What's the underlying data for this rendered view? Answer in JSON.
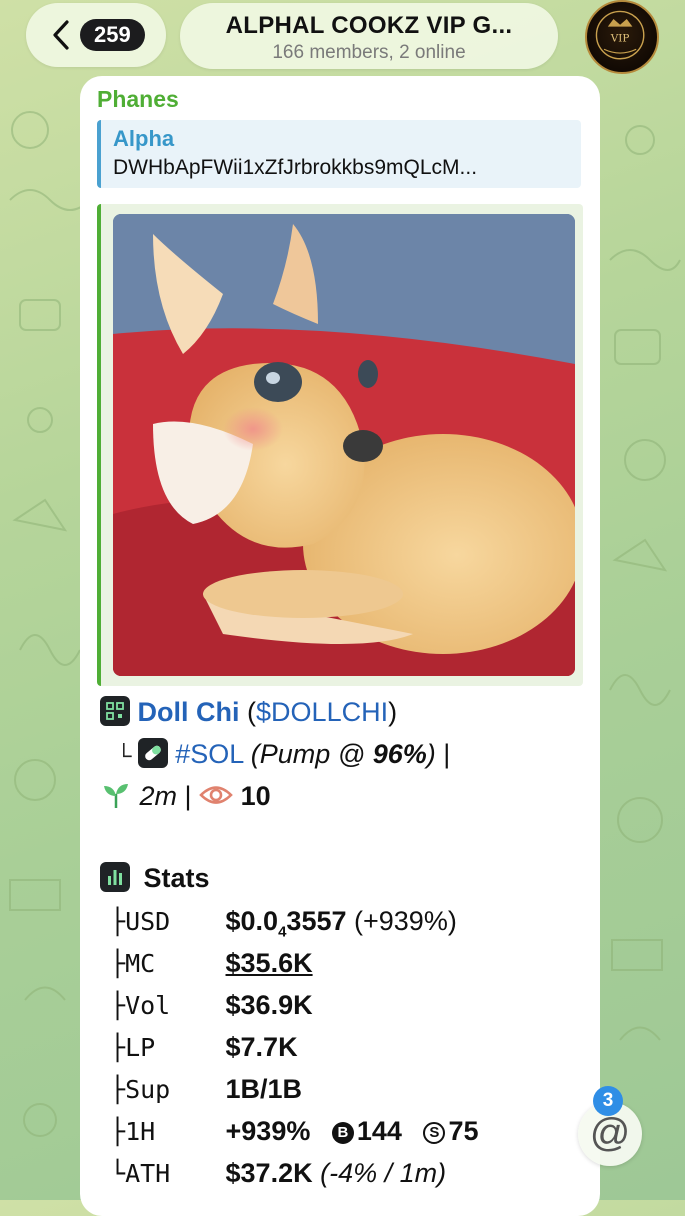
{
  "header": {
    "unread_count": "259",
    "chat_title": "ALPHAL COOKZ VIP G...",
    "chat_subtitle": "166 members, 2 online",
    "avatar_text": "VIP"
  },
  "message": {
    "sender": "Phanes",
    "reply": {
      "author": "Alpha",
      "text": "DWHbApFWii1xZfJrbrokkbs9mQLcM..."
    },
    "token_name": "Doll Chi",
    "token_ticker": "$DOLLCHI",
    "chain_tag": "#SOL",
    "pump_label": "(Pump @ ",
    "pump_pct": "96%",
    "pump_close": ")",
    "age": "2m",
    "views": "10",
    "stats_title": "Stats",
    "stats": {
      "usd_label": "USD",
      "usd_value_pre": "$0.0",
      "usd_value_sub": "4",
      "usd_value_post": "3557",
      "usd_change": "(+939%)",
      "mc_label": "MC",
      "mc_value": "$35.6K",
      "vol_label": "Vol",
      "vol_value": "$36.9K",
      "lp_label": "LP",
      "lp_value": "$7.7K",
      "sup_label": "Sup",
      "sup_value": "1B/1B",
      "h1_label": "1H",
      "h1_value": "+939%",
      "h1_buys": "144",
      "h1_sells": "75",
      "ath_label": "ATH",
      "ath_value": "$37.2K",
      "ath_change": "(-4% / 1m)"
    }
  },
  "mention_badge": "3",
  "colors": {
    "sender": "#4fae35",
    "reply_accent": "#4aa1d0",
    "link_blue": "#2463b8",
    "badge_blue": "#2f8ee6"
  }
}
